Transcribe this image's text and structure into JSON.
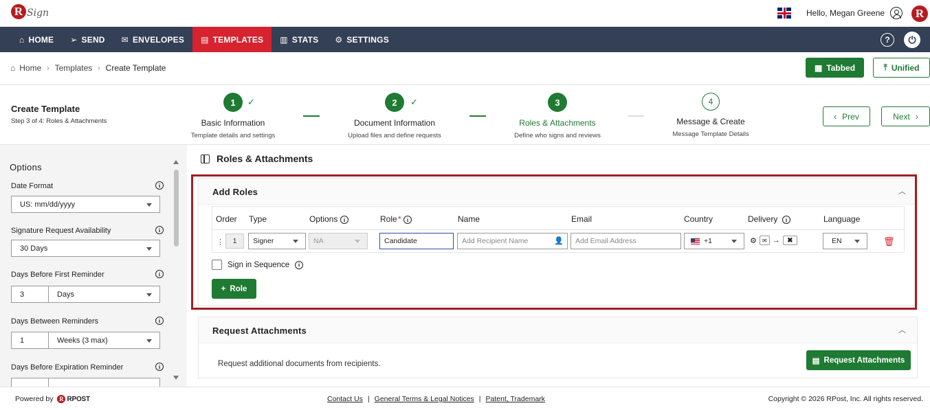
{
  "header": {
    "logo_letter": "R",
    "logo_word": "Sign",
    "greeting": "Hello, Megan Greene",
    "brand_letter": "R"
  },
  "nav": {
    "items": [
      {
        "label": "HOME",
        "icon": "home-icon",
        "glyph": "⌂"
      },
      {
        "label": "SEND",
        "icon": "send-icon",
        "glyph": "➢"
      },
      {
        "label": "ENVELOPES",
        "icon": "envelope-icon",
        "glyph": "✉"
      },
      {
        "label": "TEMPLATES",
        "icon": "template-icon",
        "glyph": "▤"
      },
      {
        "label": "STATS",
        "icon": "stats-icon",
        "glyph": "▥"
      },
      {
        "label": "SETTINGS",
        "icon": "gear-icon",
        "glyph": "⚙"
      }
    ],
    "active": "TEMPLATES",
    "help_glyph": "?",
    "power_glyph": "⏻"
  },
  "breadcrumb": {
    "home": "Home",
    "templates": "Templates",
    "current": "Create Template",
    "sep": "›"
  },
  "view_toggle": {
    "tabbed": "Tabbed",
    "unified": "Unified"
  },
  "stepper": {
    "title": "Create Template",
    "subtitle": "Step 3 of 4: Roles & Attachments",
    "steps": [
      {
        "num": "1",
        "title": "Basic Information",
        "desc": "Template details and settings",
        "state": "done"
      },
      {
        "num": "2",
        "title": "Document Information",
        "desc": "Upload files and define requests",
        "state": "done"
      },
      {
        "num": "3",
        "title": "Roles & Attachments",
        "desc": "Define who signs and reviews",
        "state": "current"
      },
      {
        "num": "4",
        "title": "Message & Create",
        "desc": "Message Template Details",
        "state": "todo"
      }
    ],
    "check_glyph": "✓",
    "prev": "Prev",
    "next": "Next"
  },
  "options": {
    "title": "Options",
    "date_format": {
      "label": "Date Format",
      "value": "US: mm/dd/yyyy"
    },
    "availability": {
      "label": "Signature Request Availability",
      "value": "30 Days"
    },
    "first_reminder": {
      "label": "Days Before First Reminder",
      "num": "3",
      "unit": "Days"
    },
    "between_reminders": {
      "label": "Days Between Reminders",
      "num": "1",
      "unit": "Weeks (3 max)"
    },
    "expiration_reminder": {
      "label": "Days Before Expiration Reminder"
    }
  },
  "main": {
    "section_title": "Roles & Attachments",
    "add_roles": {
      "title": "Add Roles",
      "columns": {
        "order": "Order",
        "type": "Type",
        "options": "Options",
        "role": "Role",
        "role_required": "*",
        "name": "Name",
        "email": "Email",
        "country": "Country",
        "delivery": "Delivery",
        "language": "Language"
      },
      "row": {
        "order": "1",
        "type": "Signer",
        "options": "NA",
        "role": "Candidate",
        "name_placeholder": "Add Recipient Name",
        "email_placeholder": "Add Email Address",
        "country_code": "+1",
        "language": "EN"
      },
      "sign_in_sequence": "Sign in Sequence",
      "add_role_button": "Role"
    },
    "attachments": {
      "title": "Request Attachments",
      "description": "Request additional documents from recipients.",
      "button": "Request Attachments"
    }
  },
  "footer": {
    "powered_by": "Powered by",
    "rpost": "RPOST",
    "links": [
      "Contact Us",
      "General Terms & Legal Notices",
      "Patent, Trademark"
    ],
    "copyright": "Copyright © 2026 RPost, Inc. All rights reserved."
  },
  "colors": {
    "nav_bg": "#344055",
    "active_tab": "#d6232f",
    "accent_green": "#1f7a33",
    "highlight_border": "#a31d24"
  }
}
